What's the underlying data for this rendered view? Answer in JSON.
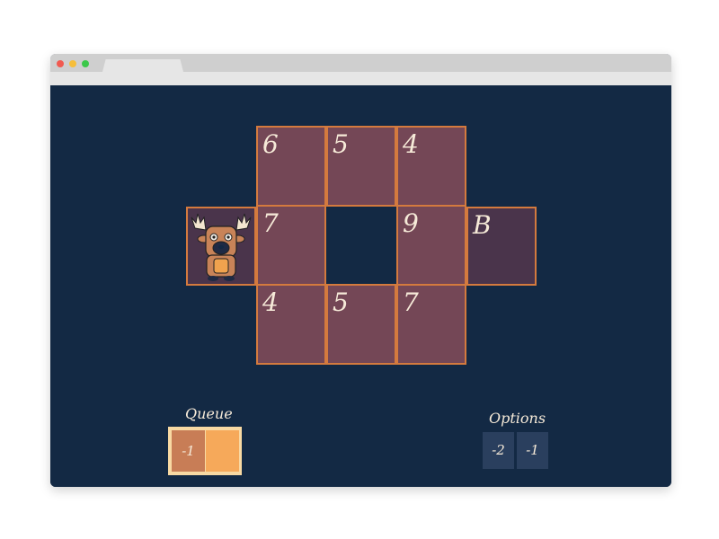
{
  "window": {
    "accent": "#d47a3e",
    "tile_color": "#744756",
    "background": "#132944"
  },
  "board": {
    "player_tile": {
      "sprite": "moose-sprite"
    },
    "top_row": [
      "6",
      "5",
      "4"
    ],
    "middle_left": "7",
    "middle_right": "9",
    "bonus": "B",
    "bottom_row": [
      "4",
      "5",
      "7"
    ]
  },
  "queue": {
    "title": "Queue",
    "items": [
      "-1",
      ""
    ]
  },
  "options": {
    "title": "Options",
    "items": [
      "-2",
      "-1"
    ]
  }
}
